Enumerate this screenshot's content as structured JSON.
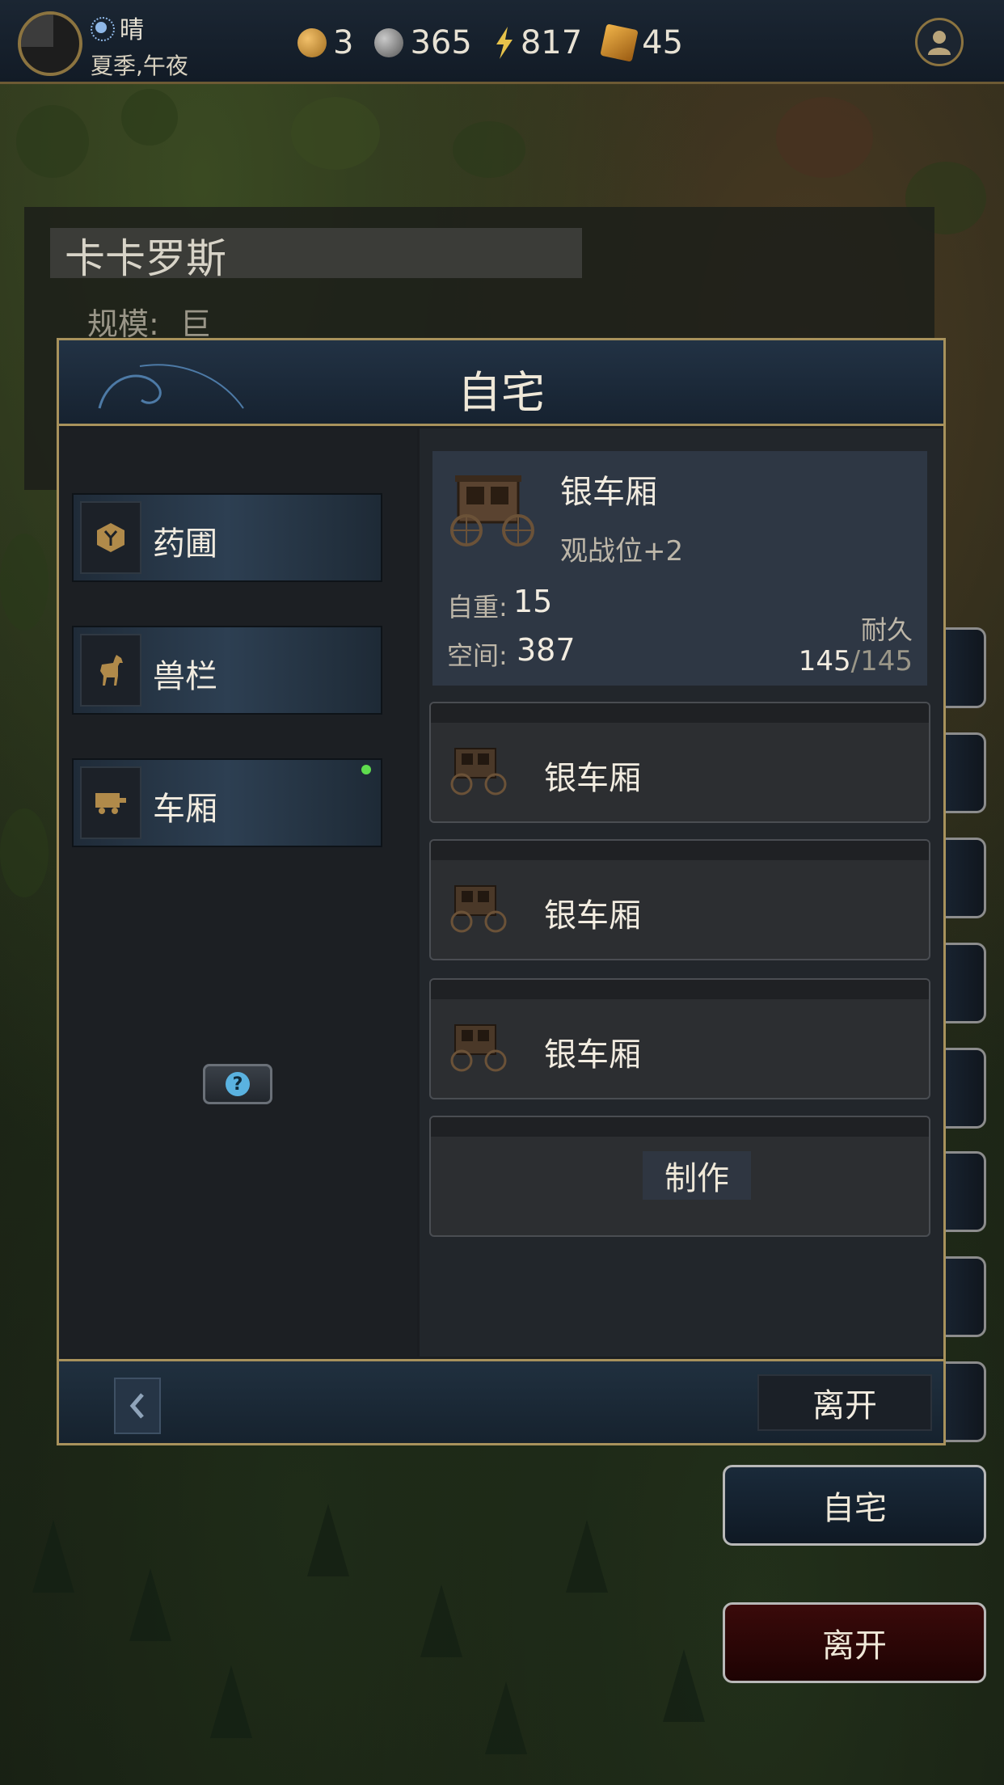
{
  "topbar": {
    "weather": "晴",
    "season_time": "夏季,午夜",
    "gold": "3",
    "silver": "365",
    "energy": "817",
    "crates": "45"
  },
  "city": {
    "name": "卡卡罗斯",
    "scale_label": "规模:",
    "scale_value": "巨"
  },
  "dialog": {
    "title": "自宅",
    "nav": [
      {
        "label": "药圃",
        "icon": "herb-icon"
      },
      {
        "label": "兽栏",
        "icon": "horse-icon"
      },
      {
        "label": "车厢",
        "icon": "cart-icon",
        "has_notification": true
      }
    ],
    "detail": {
      "name": "银车厢",
      "bonus": "观战位+2",
      "weight_label": "自重:",
      "weight": "15",
      "space_label": "空间:",
      "space": "387",
      "durability_label": "耐久",
      "durability_current": "145",
      "durability_max": "/145"
    },
    "carts": [
      {
        "label": "银车厢"
      },
      {
        "label": "银车厢"
      },
      {
        "label": "银车厢"
      }
    ],
    "craft_label": "制作",
    "leave_label": "离开"
  },
  "side_buttons": {
    "home_label": "自宅",
    "leave_label": "离开"
  },
  "colors": {
    "gold_border": "#a8925c",
    "notification": "#5fdc4e",
    "leave_red": "#3a0a0a"
  }
}
